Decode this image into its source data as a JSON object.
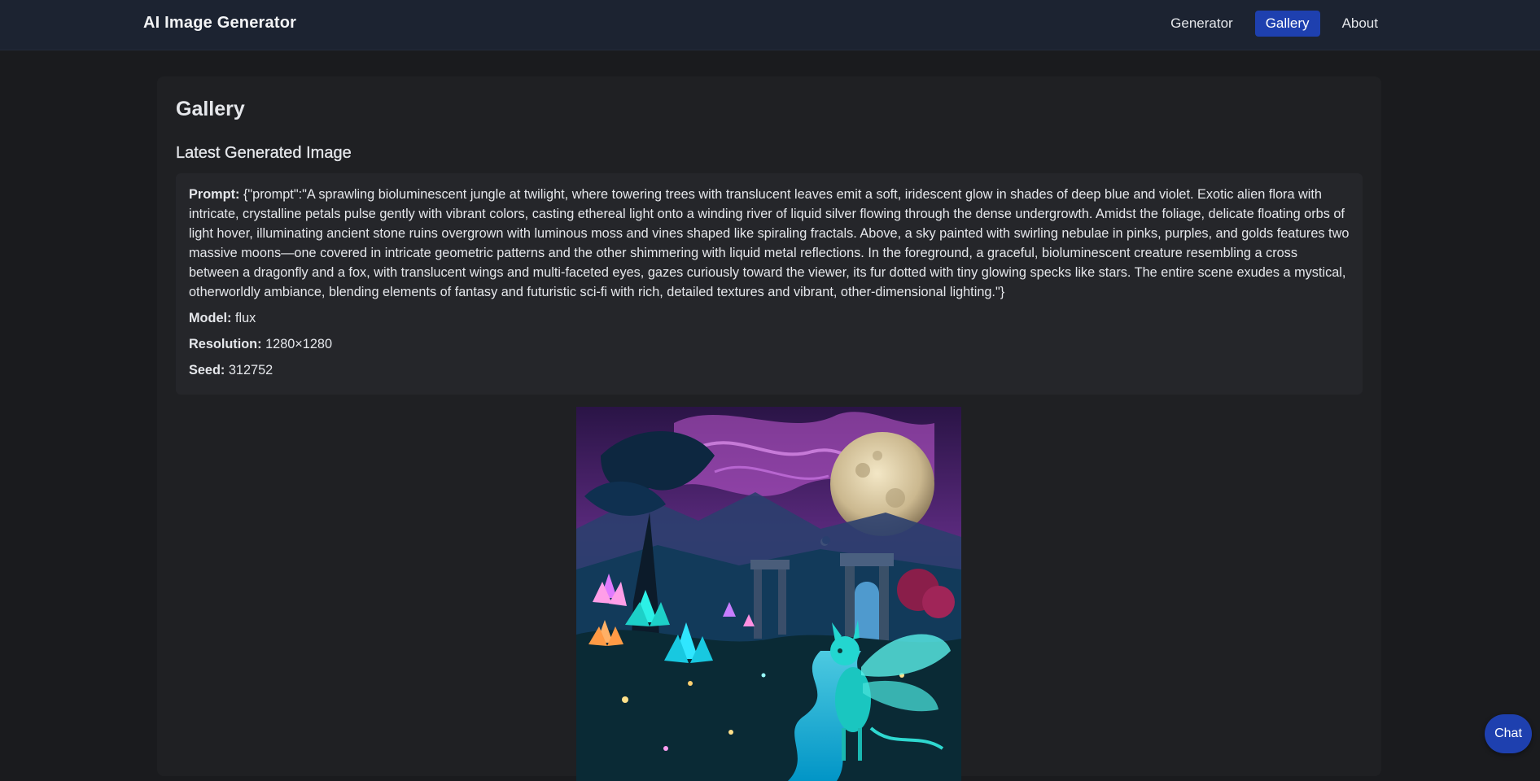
{
  "nav": {
    "brand": "AI Image Generator",
    "links": [
      {
        "label": "Generator",
        "active": false
      },
      {
        "label": "Gallery",
        "active": true
      },
      {
        "label": "About",
        "active": false
      }
    ]
  },
  "page": {
    "title": "Gallery",
    "section_title": "Latest Generated Image"
  },
  "details": {
    "prompt_label": "Prompt:",
    "prompt_value": "{\"prompt\":\"A sprawling bioluminescent jungle at twilight, where towering trees with translucent leaves emit a soft, iridescent glow in shades of deep blue and violet. Exotic alien flora with intricate, crystalline petals pulse gently with vibrant colors, casting ethereal light onto a winding river of liquid silver flowing through the dense undergrowth. Amidst the foliage, delicate floating orbs of light hover, illuminating ancient stone ruins overgrown with luminous moss and vines shaped like spiraling fractals. Above, a sky painted with swirling nebulae in pinks, purples, and golds features two massive moons—one covered in intricate geometric patterns and the other shimmering with liquid metal reflections. In the foreground, a graceful, bioluminescent creature resembling a cross between a dragonfly and a fox, with translucent wings and multi-faceted eyes, gazes curiously toward the viewer, its fur dotted with tiny glowing specks like stars. The entire scene exudes a mystical, otherworldly ambiance, blending elements of fantasy and futuristic sci-fi with rich, detailed textures and vibrant, other-dimensional lighting.\"}",
    "model_label": "Model:",
    "model_value": "flux",
    "resolution_label": "Resolution:",
    "resolution_value": "1280×1280",
    "seed_label": "Seed:",
    "seed_value": "312752"
  },
  "chat": {
    "label": "Chat"
  },
  "colors": {
    "accent": "#1e40af",
    "background": "#1a1b1e",
    "navbar": "#1c2331",
    "card": "#1f2023"
  }
}
